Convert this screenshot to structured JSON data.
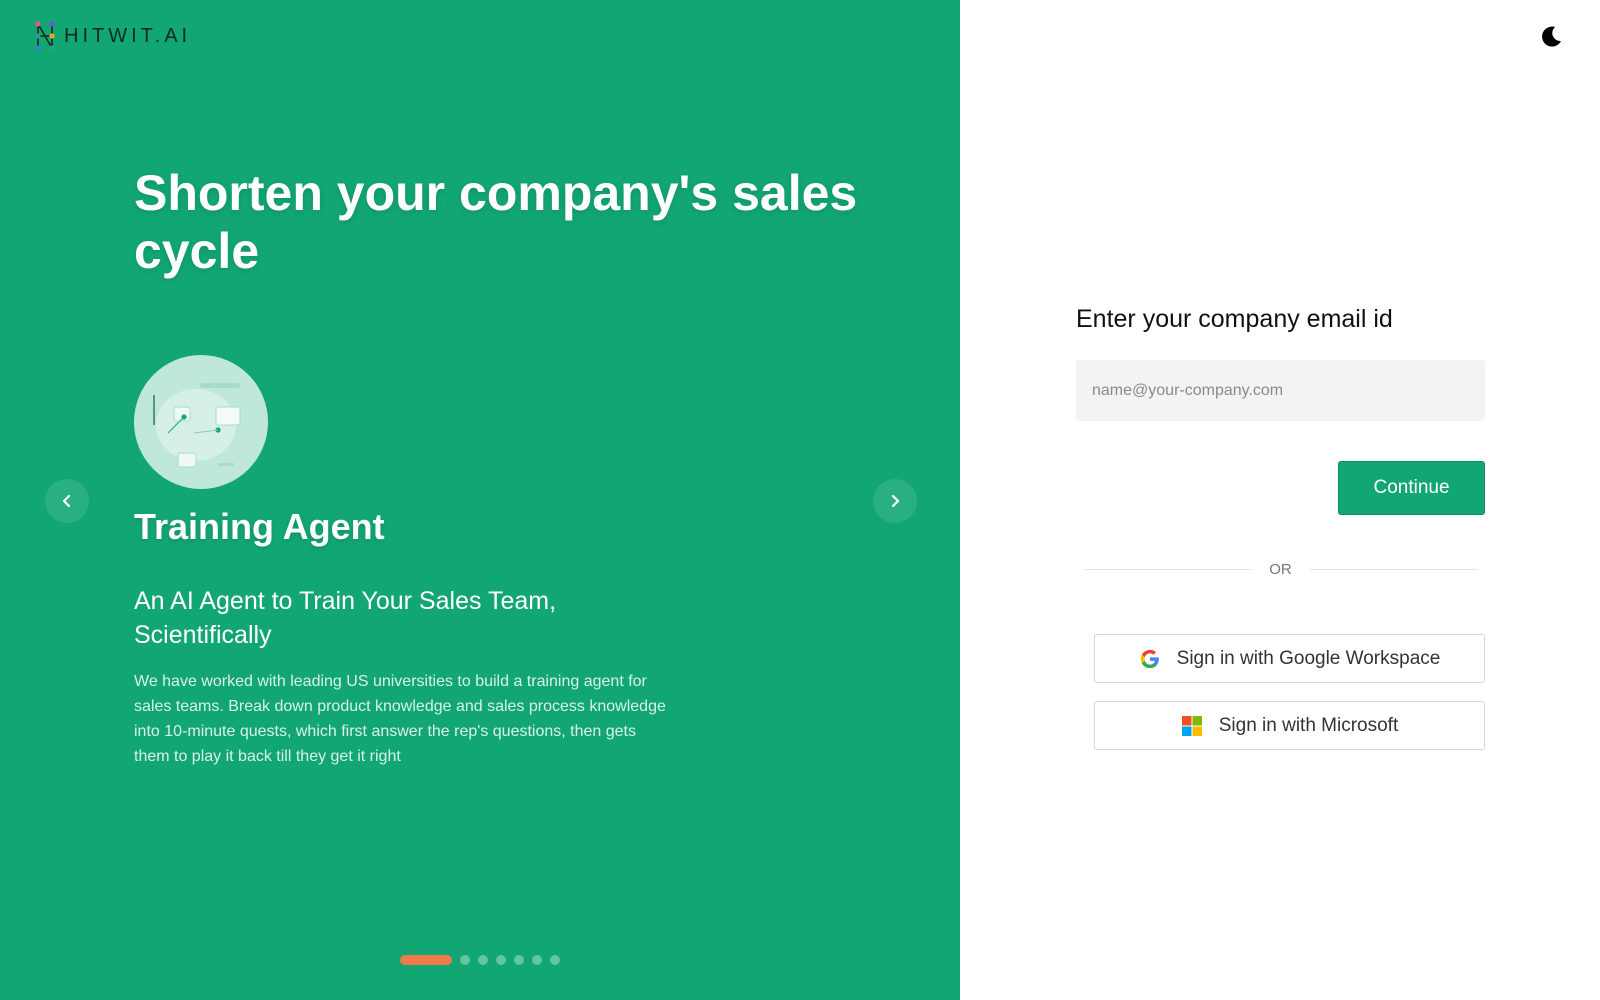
{
  "brand": {
    "name": "HITWIT.AI",
    "primary_color": "#12a673",
    "accent_color": "#f07a4a"
  },
  "hero": {
    "headline": "Shorten your company's sales cycle"
  },
  "carousel": {
    "prev_icon": "chevron-left-icon",
    "next_icon": "chevron-right-icon",
    "total_slides": 7,
    "active_index": 0,
    "current_slide": {
      "image_icon": "training-illustration",
      "title": "Training Agent",
      "subtitle": "An AI Agent to Train Your Sales Team, Scientifically",
      "description": "We have worked with leading US universities to build a training agent for sales teams. Break down product knowledge and sales process knowledge into 10-minute quests, which first answer the rep's questions, then gets them to play it back till they get it right"
    }
  },
  "theme_toggle": {
    "icon": "moon-icon"
  },
  "login": {
    "label": "Enter your company email id",
    "email_value": "",
    "email_placeholder": "name@your-company.com",
    "continue_label": "Continue",
    "divider_text": "OR",
    "google_label": "Sign in with Google Workspace",
    "microsoft_label": "Sign in with Microsoft"
  }
}
